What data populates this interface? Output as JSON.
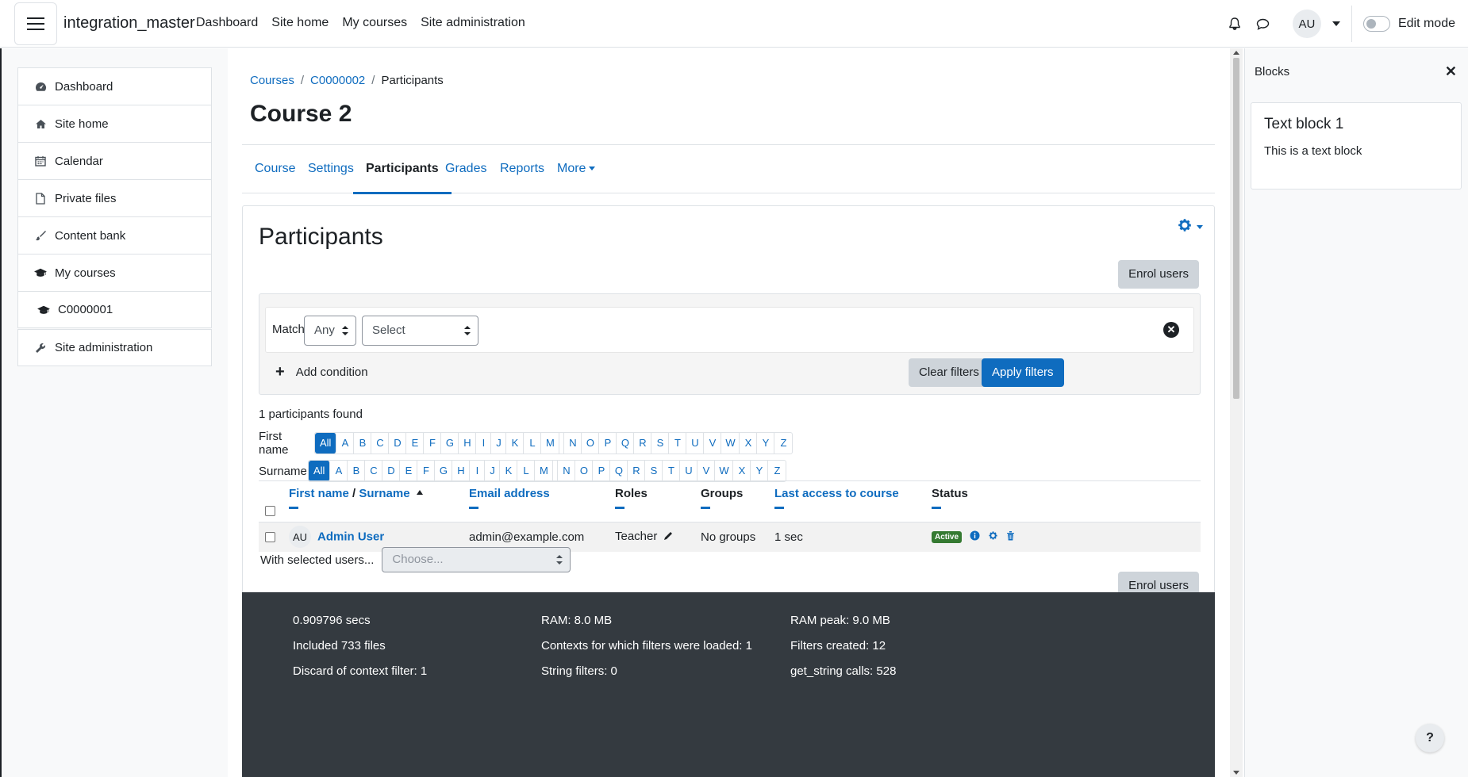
{
  "navbar": {
    "brand": "integration_master",
    "links": [
      "Dashboard",
      "Site home",
      "My courses",
      "Site administration"
    ],
    "avatar_initials": "AU",
    "edit_mode_label": "Edit mode"
  },
  "left_nav": {
    "items": [
      {
        "label": "Dashboard",
        "icon": "dashboard-icon"
      },
      {
        "label": "Site home",
        "icon": "home-icon"
      },
      {
        "label": "Calendar",
        "icon": "calendar-icon"
      },
      {
        "label": "Private files",
        "icon": "file-icon"
      },
      {
        "label": "Content bank",
        "icon": "brush-icon"
      },
      {
        "label": "My courses",
        "icon": "graduation-cap-icon"
      },
      {
        "label": "C0000001",
        "icon": "graduation-cap-icon"
      }
    ],
    "admin_item": {
      "label": "Site administration",
      "icon": "wrench-icon"
    }
  },
  "breadcrumb": {
    "items": [
      "Courses",
      "C0000002",
      "Participants"
    ]
  },
  "page_title": "Course 2",
  "secondary_nav": {
    "tabs": [
      "Course",
      "Settings",
      "Participants",
      "Grades",
      "Reports",
      "More"
    ],
    "active": "Participants"
  },
  "participants": {
    "title": "Participants",
    "enrol_label": "Enrol users",
    "filter": {
      "match_label": "Match",
      "match_value": "Any",
      "select_value": "Select",
      "add_condition": "Add condition",
      "clear_label": "Clear filters",
      "apply_label": "Apply filters"
    },
    "found_text": "1 participants found",
    "first_name_label": "First name",
    "surname_label": "Surname",
    "letters": [
      "All",
      "A",
      "B",
      "C",
      "D",
      "E",
      "F",
      "G",
      "H",
      "I",
      "J",
      "K",
      "L",
      "M",
      "N",
      "O",
      "P",
      "Q",
      "R",
      "S",
      "T",
      "U",
      "V",
      "W",
      "X",
      "Y",
      "Z"
    ],
    "columns": {
      "first_name": "First name",
      "name_sep": " / ",
      "surname": "Surname",
      "email": "Email address",
      "roles": "Roles",
      "groups": "Groups",
      "last_access": "Last access to course",
      "status": "Status"
    },
    "rows": [
      {
        "avatar": "AU",
        "name": "Admin User",
        "email": "admin@example.com",
        "role": "Teacher",
        "groups": "No groups",
        "last_access": "1 sec",
        "status": "Active"
      }
    ],
    "bulk_label": "With selected users...",
    "bulk_placeholder": "Choose..."
  },
  "blocks": {
    "title": "Blocks",
    "block_title": "Text block 1",
    "block_text": "This is a text block",
    "help_label": "?"
  },
  "footer": {
    "col1": [
      "0.909796 secs",
      "Included 733 files",
      "Discard of context filter: 1"
    ],
    "col2": [
      "RAM: 8.0 MB",
      "Contexts for which filters were loaded: 1",
      "String filters: 0"
    ],
    "col3": [
      "RAM peak: 9.0 MB",
      "Filters created: 12",
      "get_string calls: 528"
    ]
  },
  "colors": {
    "primary": "#0f6cbf",
    "success": "#357a32",
    "footer": "#343a40"
  }
}
